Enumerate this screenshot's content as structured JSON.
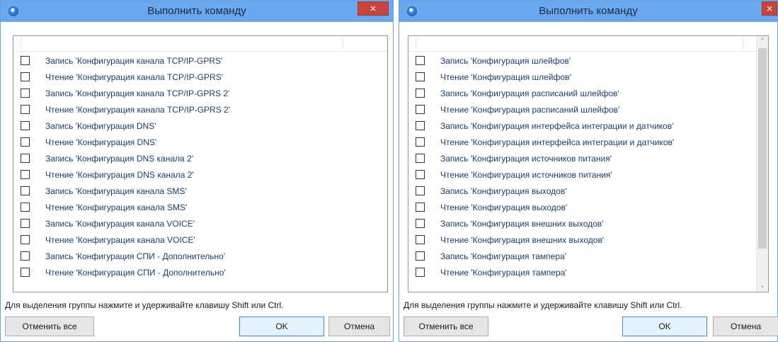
{
  "left_dialog": {
    "title": "Выполнить команду",
    "close_label": "×",
    "items": [
      "Запись 'Конфигурация канала TCP/IP-GPRS'",
      "Чтение 'Конфигурация канала TCP/IP-GPRS'",
      "Запись 'Конфигурация канала TCP/IP-GPRS 2'",
      "Чтение 'Конфигурация канала TCP/IP-GPRS 2'",
      "Запись 'Конфигурация DNS'",
      "Чтение 'Конфигурация DNS'",
      "Запись 'Конфигурация DNS канала 2'",
      "Чтение 'Конфигурация DNS канала 2'",
      "Запись 'Конфигурация канала SMS'",
      "Чтение 'Конфигурация канала SMS'",
      "Запись 'Конфигурация канала VOICE'",
      "Чтение 'Конфигурация канала VOICE'",
      "Запись 'Конфигурация СПИ - Дополнительно'",
      "Чтение 'Конфигурация СПИ - Дополнительно'"
    ],
    "hint": "Для выделения группы нажмите и удерживайте клавишу Shift или Ctrl.",
    "clear_all_label": "Отменить все",
    "ok_label": "OK",
    "cancel_label": "Отмена"
  },
  "right_dialog": {
    "title": "Выполнить команду",
    "close_label": "×",
    "items": [
      "Запись 'Конфигурация шлейфов'",
      "Чтение 'Конфигурация шлейфов'",
      "Запись 'Конфигурация расписаний шлейфов'",
      "Чтение 'Конфигурация расписаний шлейфов'",
      "Запись 'Конфигурация интерфейса интеграции и датчиков'",
      "Чтение 'Конфигурация интерфейса интеграции и датчиков'",
      "Запись 'Конфигурация источников питания'",
      "Чтение 'Конфигурация источников питания'",
      "Запись 'Конфигурация выходов'",
      "Чтение 'Конфигурация выходов'",
      "Запись 'Конфигурация внешних выходов'",
      "Чтение 'Конфигурация внешних выходов'",
      "Запись 'Конфигурация тампера'",
      "Чтение 'Конфигурация тампера'"
    ],
    "hint": "Для выделения группы нажмите и удерживайте клавишу Shift или Ctrl.",
    "clear_all_label": "Отменить все",
    "ok_label": "OK",
    "cancel_label": "Отмена",
    "scroll_up_glyph": "⌃",
    "scroll_down_glyph": "⌄"
  },
  "colors": {
    "titlebar": "#6aa7ee",
    "close_button": "#c7463b",
    "item_text": "#1b3c6b",
    "ok_border": "#3c8ae0"
  },
  "icons": [
    "app-icon",
    "close-icon",
    "checkbox-icon"
  ]
}
